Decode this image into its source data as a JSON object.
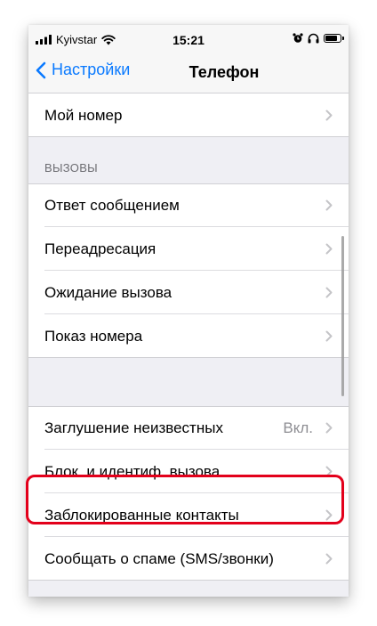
{
  "status_bar": {
    "carrier": "Kyivstar",
    "time": "15:21"
  },
  "nav": {
    "back_label": "Настройки",
    "title": "Телефон"
  },
  "rows_top": [
    {
      "label": "Мой номер"
    }
  ],
  "calls_section": {
    "header": "ВЫЗОВЫ",
    "rows": [
      {
        "label": "Ответ сообщением"
      },
      {
        "label": "Переадресация"
      },
      {
        "label": "Ожидание вызова"
      },
      {
        "label": "Показ номера"
      }
    ]
  },
  "bottom_section": {
    "rows": [
      {
        "label": "Заглушение неизвестных",
        "value": "Вкл."
      },
      {
        "label": "Блок. и идентиф. вызова"
      },
      {
        "label": "Заблокированные контакты"
      },
      {
        "label": "Сообщать о спаме (SMS/звонки)"
      }
    ]
  },
  "colors": {
    "accent": "#0a7aff",
    "highlight": "#e3001b",
    "background": "#efeff4"
  }
}
